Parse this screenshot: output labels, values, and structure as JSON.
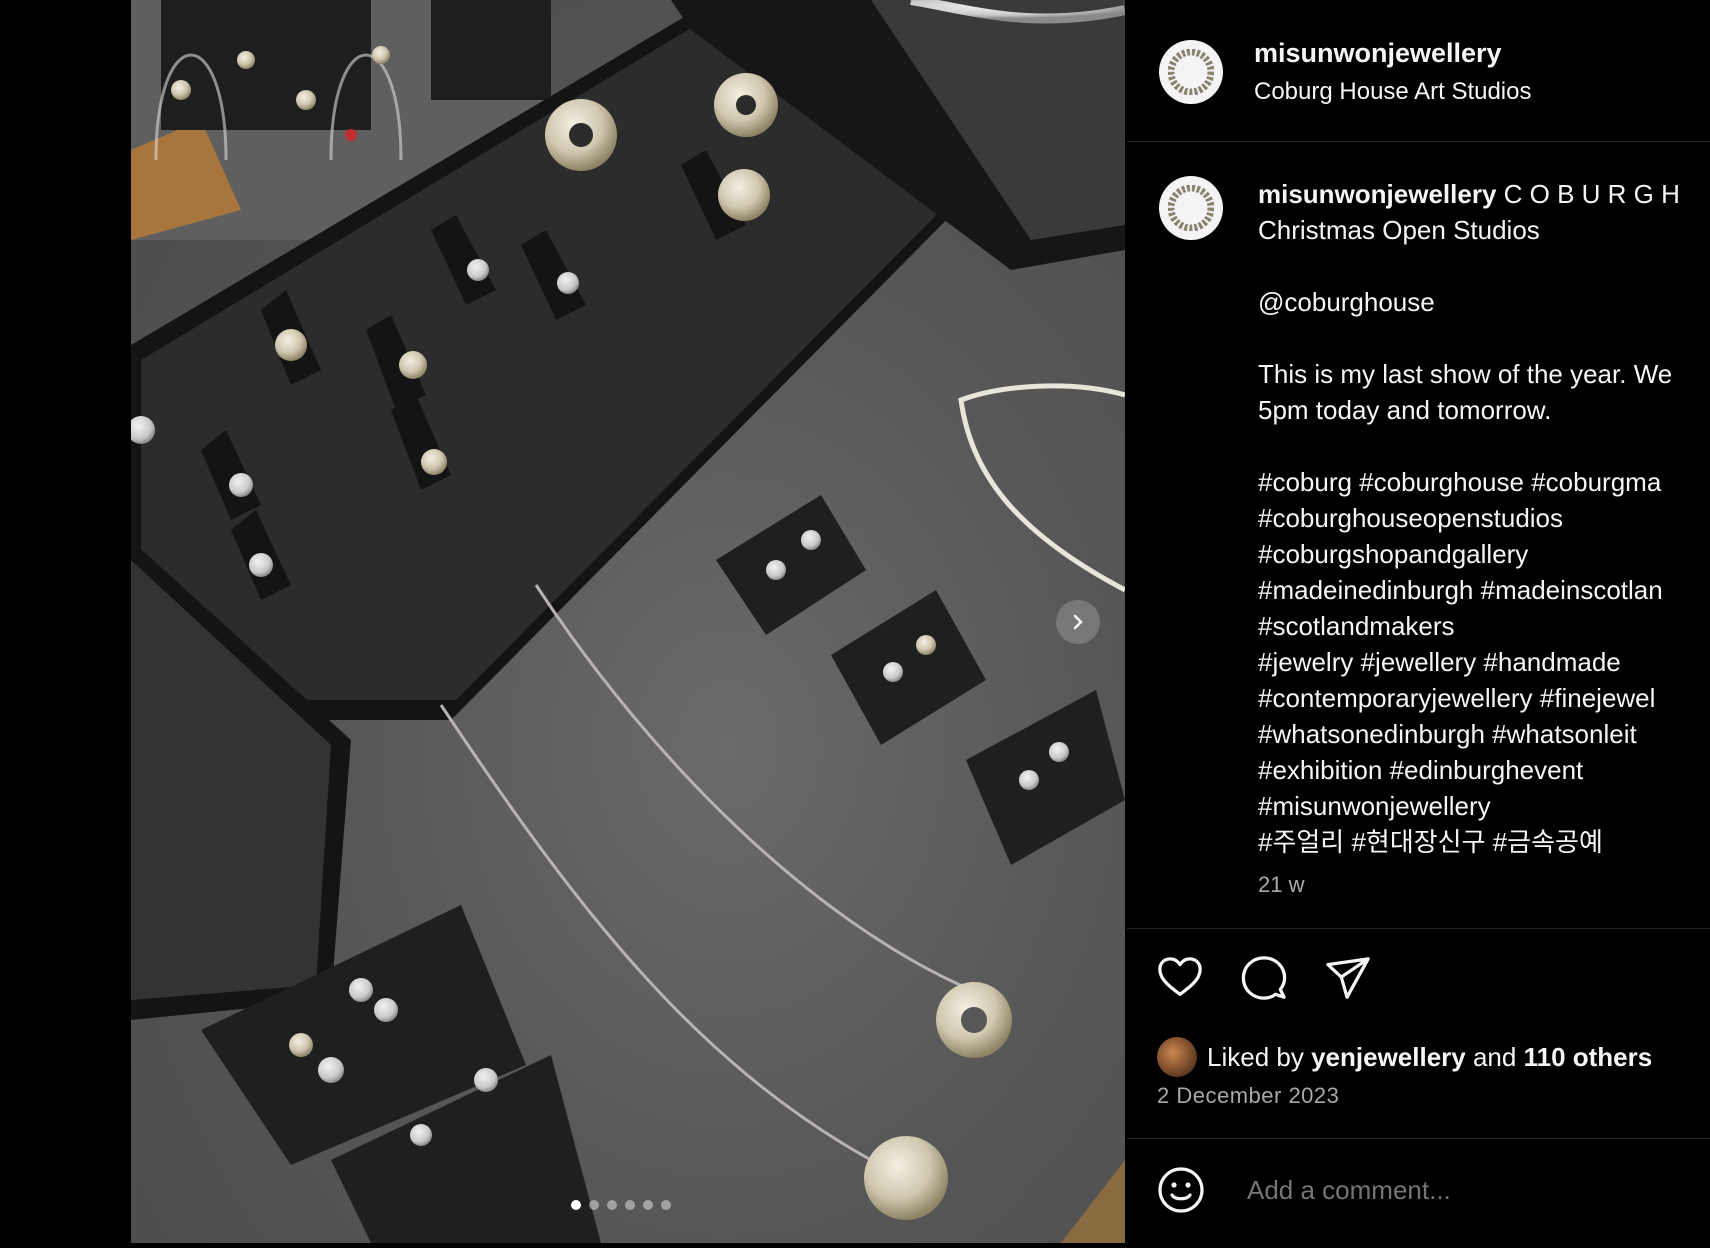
{
  "post": {
    "image_alt": "Jewellery display: rings, earrings and necklaces on felt trays",
    "carousel_dot_count": 6,
    "carousel_active_index": 0
  },
  "header": {
    "username": "misunwonjewellery",
    "location": "Coburg House Art Studios"
  },
  "caption": {
    "username": "misunwonjewellery",
    "title": "C O B U R G H",
    "line2": "Christmas Open Studios",
    "mention": "@coburghouse",
    "body_line1": "This is my last show of the year. We",
    "body_line2": "5pm today and tomorrow.",
    "hashtag_lines": [
      "#coburg #coburghouse #coburgma",
      "#coburghouseopenstudios",
      "#coburgshopandgallery",
      "#madeinedinburgh #madeinscotlan",
      "#scotlandmakers",
      "#jewelry #jewellery #handmade",
      "#contemporaryjewellery #finejewel",
      "#whatsonedinburgh #whatsonleit",
      "#exhibition #edinburghevent",
      "#misunwonjewellery",
      "#주얼리 #현대장신구 #금속공예"
    ],
    "time": "21 w"
  },
  "likes": {
    "prefix": "Liked by",
    "user": "yenjewellery",
    "and": "and",
    "others": "110 others"
  },
  "date": "2 December 2023",
  "comment": {
    "placeholder": "Add a comment..."
  },
  "icons": {
    "like": "heart-icon",
    "comment": "speech-bubble-icon",
    "share": "paper-plane-icon",
    "emoji": "smiley-icon",
    "next": "chevron-right-icon"
  }
}
